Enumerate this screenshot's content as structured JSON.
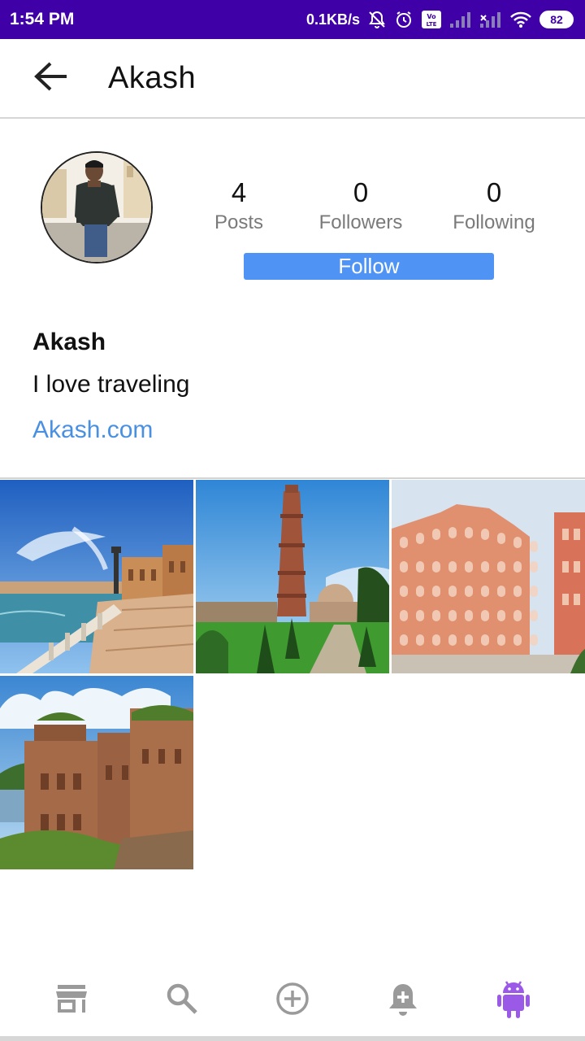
{
  "status_bar": {
    "time": "1:54 PM",
    "speed": "0.1KB/s",
    "battery": "82",
    "volte": "Vo LTE",
    "background_color": "#3f00a8"
  },
  "app_bar": {
    "title": "Akash",
    "back_icon": "arrow-left-icon"
  },
  "profile": {
    "stats": [
      {
        "value": "4",
        "label": "Posts"
      },
      {
        "value": "0",
        "label": "Followers"
      },
      {
        "value": "0",
        "label": "Following"
      }
    ],
    "follow_label": "Follow",
    "follow_color": "#4f94f5",
    "name": "Akash",
    "bio": "I love traveling",
    "website": "Akash.com",
    "link_color": "#4a90e2"
  },
  "posts": [
    {
      "icon": "plaza-de-espana-photo"
    },
    {
      "icon": "qutub-minar-photo"
    },
    {
      "icon": "hawa-mahal-photo"
    },
    {
      "icon": "orchha-chhatris-photo"
    }
  ],
  "bottom_nav": {
    "items": [
      {
        "name": "home",
        "icon": "store-icon"
      },
      {
        "name": "search",
        "icon": "search-icon"
      },
      {
        "name": "add",
        "icon": "add-circle-icon"
      },
      {
        "name": "notifications",
        "icon": "bell-plus-icon"
      },
      {
        "name": "profile",
        "icon": "android-icon"
      }
    ],
    "active_color": "#9b59e8",
    "inactive_color": "#9a9a9a"
  }
}
